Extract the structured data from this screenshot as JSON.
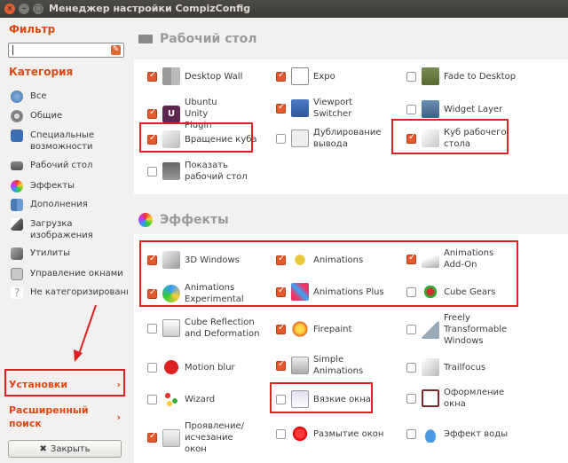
{
  "window": {
    "title": "Менеджер настройки CompizConfig"
  },
  "sidebar": {
    "filter_label": "Фильтр",
    "filter_value": "",
    "category_label": "Категория",
    "categories": [
      {
        "label": "Все",
        "icon": "globe-icon"
      },
      {
        "label": "Общие",
        "icon": "gear-icon"
      },
      {
        "label": "Специальные возможности",
        "icon": "accessibility-icon"
      },
      {
        "label": "Рабочий стол",
        "icon": "desktop-icon"
      },
      {
        "label": "Эффекты",
        "icon": "effects-icon"
      },
      {
        "label": "Дополнения",
        "icon": "extras-icon"
      },
      {
        "label": "Загрузка изображения",
        "icon": "image-loading-icon"
      },
      {
        "label": "Утилиты",
        "icon": "utilities-icon"
      },
      {
        "label": "Управление окнами",
        "icon": "window-management-icon"
      },
      {
        "label": "Не категоризированные",
        "icon": "uncategorized-icon"
      }
    ],
    "settings_label": "Установки",
    "advanced_label": "Расширенный поиск",
    "close_label": "Закрыть"
  },
  "sections": [
    {
      "title": "Рабочий стол",
      "plugins": [
        {
          "label": "Desktop Wall",
          "checked": true
        },
        {
          "label": "Expo",
          "checked": true
        },
        {
          "label": "Fade to Desktop",
          "checked": false
        },
        {
          "label": "Ubuntu Unity Plugin",
          "checked": true
        },
        {
          "label": "Viewport Switcher",
          "checked": true
        },
        {
          "label": "Widget Layer",
          "checked": false
        },
        {
          "label": "Вращение куба",
          "checked": true
        },
        {
          "label": "Дублирование вывода",
          "checked": false
        },
        {
          "label": "Куб рабочего стола",
          "checked": true
        },
        {
          "label": "Показать рабочий стол",
          "checked": false
        }
      ]
    },
    {
      "title": "Эффекты",
      "plugins": [
        {
          "label": "3D Windows",
          "checked": true
        },
        {
          "label": "Animations",
          "checked": true
        },
        {
          "label": "Animations Add-On",
          "checked": true
        },
        {
          "label": "Animations Experimental",
          "checked": true
        },
        {
          "label": "Animations Plus",
          "checked": true
        },
        {
          "label": "Cube Gears",
          "checked": false
        },
        {
          "label": "Cube Reflection and Deformation",
          "checked": false
        },
        {
          "label": "Firepaint",
          "checked": true
        },
        {
          "label": "Freely Transformable Windows",
          "checked": false
        },
        {
          "label": "Motion blur",
          "checked": false
        },
        {
          "label": "Simple Animations",
          "checked": true
        },
        {
          "label": "Trailfocus",
          "checked": false
        },
        {
          "label": "Wizard",
          "checked": false
        },
        {
          "label": "Вязкие окна",
          "checked": false
        },
        {
          "label": "Оформление окна",
          "checked": false
        },
        {
          "label": "Проявление/ исчезание окон",
          "checked": true
        },
        {
          "label": "Размытие окон",
          "checked": false
        },
        {
          "label": "Эффект воды",
          "checked": false
        }
      ]
    }
  ]
}
